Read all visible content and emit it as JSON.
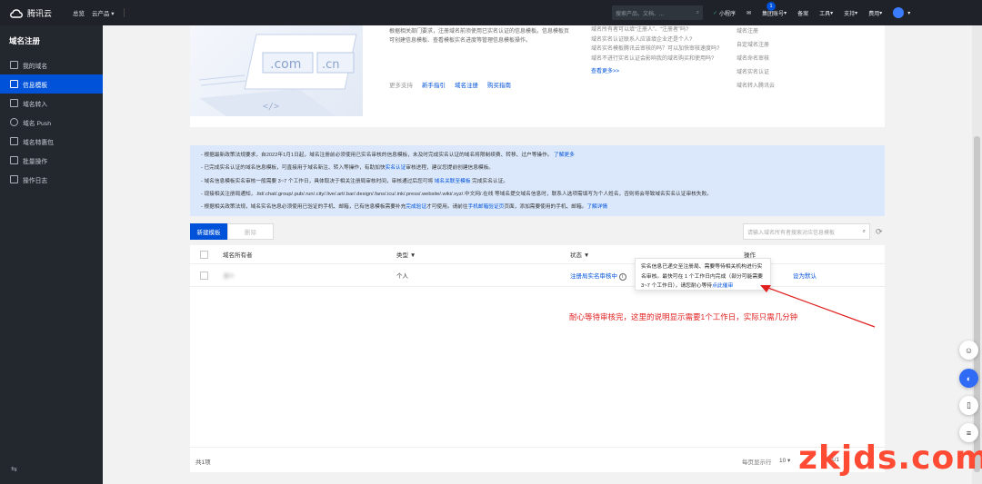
{
  "topbar": {
    "brand": "腾讯云",
    "nav": [
      "总览",
      "云产品"
    ],
    "search_placeholder": "搜索产品、文档、...",
    "right_items": [
      "小程序",
      "集团账号",
      "备案",
      "工具",
      "支持",
      "费用"
    ],
    "message_badge": "1"
  },
  "sidebar": {
    "title": "域名注册",
    "items": [
      {
        "label": "我的域名",
        "active": false
      },
      {
        "label": "信息模板",
        "active": true
      },
      {
        "label": "域名转入",
        "active": false
      },
      {
        "label": "域名 Push",
        "active": false
      },
      {
        "label": "域名特惠包",
        "active": false
      },
      {
        "label": "批量操作",
        "active": false
      },
      {
        "label": "操作日志",
        "active": false
      }
    ]
  },
  "intro": {
    "desc": "根据相关部门要求，注册域名前须使用已实名认证的信息模板。信息模板页可创建信息模板、查看模板实名进度等管理信息模板操作。",
    "illus_text_1": ".com",
    "illus_text_2": ".cn",
    "links": [
      "更多支持",
      "新手指引",
      "域名注册",
      "购买指南"
    ],
    "faq": [
      "域名所有者可以填“注册人”、“注册者”吗?",
      "域名实名认证联系人应该填企业还是个人?",
      "域名实名模板腾讯云审核的吗？可以加快审核速度吗?",
      "域名不进行实名认证会影响我的域名购买和使用吗?"
    ],
    "faq_more": "查看更多>>",
    "faq2": [
      "域名注册",
      "自定域名注册",
      "域名命名审核",
      "域名实名认证",
      "域名转入腾讯云"
    ]
  },
  "notice": {
    "lines": [
      {
        "text": "- 根据最新政策法规要求，自2022年1月1日起，域名注册前必须使用已实名审核的信息模板，未及时完成实名认证的域名将限制续费、转移、过户等操作。",
        "link": "了解更多"
      },
      {
        "text": "- 已完成实名认证的域名信息模板，可直接用于域名新注、转入等操作，有助加快",
        "link": "实名认证",
        "tail": "审核进程，建议您提前创建信息模板。"
      },
      {
        "text": "- 域名信息模板实名审核一般需要 3~7 个工作日，具体取决于相关注册局审核时间，审核通过后您可将",
        "link": "域名关联至模板",
        "tail": "完成实名认证。"
      },
      {
        "text": "- 现接相关注册局通知，.ltd/.chat/.group/.pub/.run/.city/.live/.art/.bar/.design/.fans/.icu/.ink/.press/.website/.wiki/.xyz/.中文网/.在线 等域名提交域名信息时，联系人选项需填写为个人姓名，否则将会导致域名实名认证审核失败。"
      },
      {
        "text": "- 根据相关政策法规，域名实名信息必须使用已验证的手机、邮箱，已有信息模板需要补充",
        "link": "完成验证",
        "tail": "才可使用。请前往",
        "link2": "手机邮箱验证页",
        "tail2": "页面，添加需要使用的手机、邮箱。",
        "link3": "了解详情"
      }
    ]
  },
  "toolbar": {
    "new_label": "新建模板",
    "delete_label": "删除",
    "search_placeholder": "请输入域名所有者搜索对应信息模板"
  },
  "table": {
    "headers": [
      "域名所有者",
      "类型",
      "状态",
      "操作"
    ],
    "rows": [
      {
        "owner": "潘叶",
        "type": "个人",
        "status": "注册局实名审核中",
        "op": "设为默认"
      }
    ],
    "total": "共1项",
    "per_page_label": "每页显示行",
    "per_page_value": "10",
    "page": "1/1"
  },
  "tooltip": {
    "text": "实名信息已递交至注册局、需要等待相关机构进行实名审核。最快可在 1 个工作日内完成（部分可能需要 3~7 个工作日），请您耐心等待",
    "link": "点此催审"
  },
  "annotation": "耐心等待审核完，这里的说明显示需要1个工作日，实际只需几分钟",
  "watermark": "zkjds.com",
  "colors": {
    "brand": "#0052d9",
    "annotation": "#e02020",
    "watermark": "#ff4b34"
  }
}
